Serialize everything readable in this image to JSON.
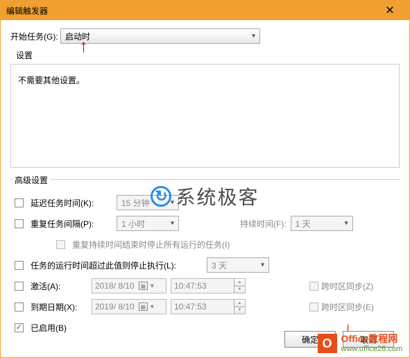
{
  "title": "编辑触发器",
  "begin_task": {
    "label": "开始任务(G):",
    "value": "启动时"
  },
  "settings_header": "设置",
  "settings_text": "不需要其他设置。",
  "advanced_header": "高级设置",
  "delay": {
    "label": "延迟任务时间(K):",
    "value": "15 分钟"
  },
  "repeat": {
    "label": "重复任务间隔(P):",
    "value": "1 小时",
    "duration_label": "持续时间(F):",
    "duration_value": "1 天",
    "stop_label": "重复持续时间结束时停止所有运行的任务(I)"
  },
  "stop_after": {
    "label": "任务的运行时间超过此值则停止执行(L):",
    "value": "3 天"
  },
  "activate": {
    "label": "激活(A):",
    "date": "2018/ 8/10",
    "time": "10:47:53",
    "tz_label": "跨时区同步(Z)"
  },
  "expire": {
    "label": "到期日期(X):",
    "date": "2019/ 8/10",
    "time": "10:47:53",
    "tz_label": "跨时区同步(E)"
  },
  "enabled_label": "已启用(B)",
  "buttons": {
    "ok": "确定",
    "cancel": "取消"
  },
  "watermark1": "系统极客",
  "watermark2": {
    "line1": "Office教程网",
    "line2": "www.office26.com"
  }
}
